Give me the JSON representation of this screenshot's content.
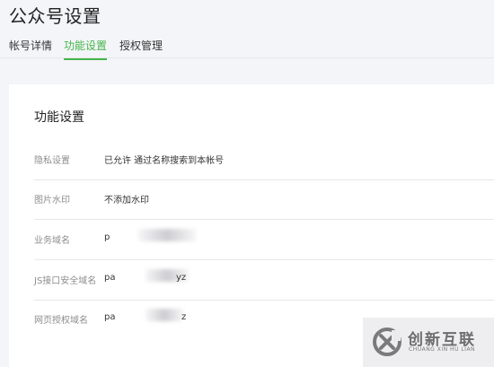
{
  "page": {
    "title": "公众号设置"
  },
  "tabs": [
    {
      "label": "帐号详情",
      "active": false
    },
    {
      "label": "功能设置",
      "active": true
    },
    {
      "label": "授权管理",
      "active": false
    }
  ],
  "section": {
    "title": "功能设置",
    "rows": [
      {
        "label": "隐私设置",
        "value": "已允许 通过名称搜索到本帐号"
      },
      {
        "label": "图片水印",
        "value": "不添加水印"
      },
      {
        "label": "业务域名",
        "value": "p"
      },
      {
        "label": "JS接口安全域名",
        "value": "pa",
        "suffix": "yz"
      },
      {
        "label": "网页授权域名",
        "value": "pa",
        "suffix": "z"
      }
    ]
  },
  "watermark": {
    "brand_cn": "创新互联",
    "brand_en": "CHUANG XIN HU LIAN"
  },
  "colors": {
    "accent": "#44b549"
  }
}
